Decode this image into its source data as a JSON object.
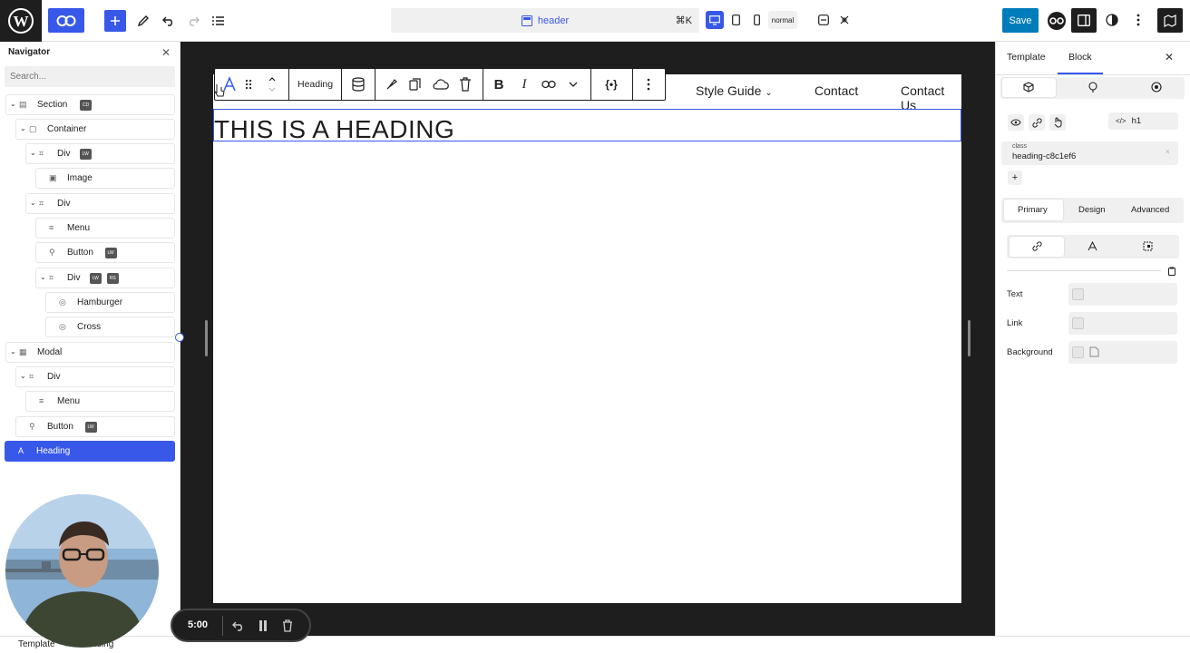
{
  "topbar": {
    "command_label": "header",
    "command_shortcut": "⌘K",
    "mode": "normal",
    "save_label": "Save",
    "accent": "#3858e9",
    "save_color": "#007cba"
  },
  "navigator": {
    "title": "Navigator",
    "search_placeholder": "Search...",
    "items": [
      {
        "label": "Section",
        "badges": [
          "CD"
        ],
        "icon": "section-icon"
      },
      {
        "label": "Container",
        "badges": [],
        "icon": "container-icon"
      },
      {
        "label": "Div",
        "badges": [
          "LW"
        ],
        "icon": "div-icon"
      },
      {
        "label": "Image",
        "badges": [],
        "icon": "image-icon"
      },
      {
        "label": "Div",
        "badges": [],
        "icon": "div-icon"
      },
      {
        "label": "Menu",
        "badges": [],
        "icon": "menu-icon"
      },
      {
        "label": "Button",
        "badges": [
          "LW"
        ],
        "icon": "button-icon"
      },
      {
        "label": "Div",
        "badges": [
          "LW",
          "RS"
        ],
        "icon": "div-icon"
      },
      {
        "label": "Hamburger",
        "badges": [],
        "icon": "svg-icon"
      },
      {
        "label": "Cross",
        "badges": [],
        "icon": "svg-icon"
      },
      {
        "label": "Modal",
        "badges": [],
        "icon": "modal-icon"
      },
      {
        "label": "Div",
        "badges": [],
        "icon": "div-icon"
      },
      {
        "label": "Menu",
        "badges": [],
        "icon": "menu-icon"
      },
      {
        "label": "Button",
        "badges": [
          "LW"
        ],
        "icon": "button-icon"
      },
      {
        "label": "Heading",
        "badges": [],
        "icon": "heading-icon"
      }
    ]
  },
  "canvas": {
    "menu": [
      "Style Guide",
      "Contact",
      "Contact Us"
    ],
    "heading_text": "THIS IS A HEADING",
    "block_label": "Heading"
  },
  "right_panel": {
    "tabs": [
      "Template",
      "Block"
    ],
    "tag": "h1",
    "class_label": "class",
    "class_value": "heading-c8c1ef6",
    "subtabs": [
      "Primary",
      "Design",
      "Advanced"
    ],
    "fields": [
      "Text",
      "Link",
      "Background"
    ]
  },
  "breadcrumb": [
    "Template",
    "Heading"
  ],
  "recorder": {
    "time": "5:00"
  }
}
